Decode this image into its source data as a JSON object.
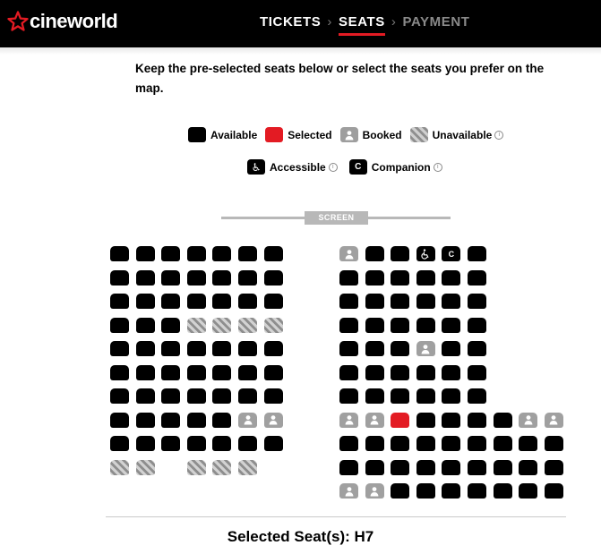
{
  "brand": {
    "name": "cineworld",
    "accent": "#e31b23"
  },
  "nav": {
    "steps": [
      {
        "label": "TICKETS",
        "state": "done"
      },
      {
        "label": "SEATS",
        "state": "active"
      },
      {
        "label": "PAYMENT",
        "state": "future"
      }
    ]
  },
  "intro": "Keep the pre-selected seats below or select the seats you prefer on the map.",
  "legend": {
    "available": "Available",
    "selected": "Selected",
    "booked": "Booked",
    "unavailable": "Unavailable",
    "accessible": "Accessible",
    "companion": "Companion",
    "companion_mark": "C"
  },
  "screen_label": "SCREEN",
  "seat_map": {
    "left_block": [
      [
        "a",
        "a",
        "a",
        "a",
        "a",
        "a",
        "a"
      ],
      [
        "a",
        "a",
        "a",
        "a",
        "a",
        "a",
        "a"
      ],
      [
        "a",
        "a",
        "a",
        "a",
        "a",
        "a",
        "a"
      ],
      [
        "a",
        "a",
        "a",
        "u",
        "u",
        "u",
        "u"
      ],
      [
        "a",
        "a",
        "a",
        "a",
        "a",
        "a",
        "a"
      ],
      [
        "a",
        "a",
        "a",
        "a",
        "a",
        "a",
        "a"
      ],
      [
        "a",
        "a",
        "a",
        "a",
        "a",
        "a",
        "a"
      ],
      [
        "a",
        "a",
        "a",
        "a",
        "a",
        "b",
        "b"
      ],
      [
        "a",
        "a",
        "a",
        "a",
        "a",
        "a",
        "a"
      ],
      [
        "u",
        "u",
        "",
        "u",
        "u",
        "u",
        ""
      ]
    ],
    "right_block": [
      [
        "b",
        "a",
        "a",
        "x",
        "c",
        "a",
        "",
        "",
        "",
        ""
      ],
      [
        "a",
        "a",
        "a",
        "a",
        "a",
        "a",
        "",
        "",
        "",
        ""
      ],
      [
        "a",
        "a",
        "a",
        "a",
        "a",
        "a",
        "",
        "",
        "",
        ""
      ],
      [
        "a",
        "a",
        "a",
        "a",
        "a",
        "a",
        "",
        "",
        "",
        ""
      ],
      [
        "a",
        "a",
        "a",
        "b",
        "a",
        "a",
        "",
        "",
        "",
        ""
      ],
      [
        "a",
        "a",
        "a",
        "a",
        "a",
        "a",
        "",
        "",
        "",
        ""
      ],
      [
        "a",
        "a",
        "a",
        "a",
        "a",
        "a",
        "",
        "",
        "",
        ""
      ],
      [
        "b",
        "b",
        "s",
        "a",
        "a",
        "a",
        "a",
        "b",
        "b"
      ],
      [
        "a",
        "a",
        "a",
        "a",
        "a",
        "a",
        "a",
        "a",
        "a"
      ],
      [
        "a",
        "a",
        "a",
        "a",
        "a",
        "a",
        "a",
        "a",
        "a"
      ],
      [
        "b",
        "b",
        "a",
        "a",
        "a",
        "a",
        "a",
        "a",
        "a"
      ]
    ]
  },
  "summary": "Selected Seat(s): H7"
}
